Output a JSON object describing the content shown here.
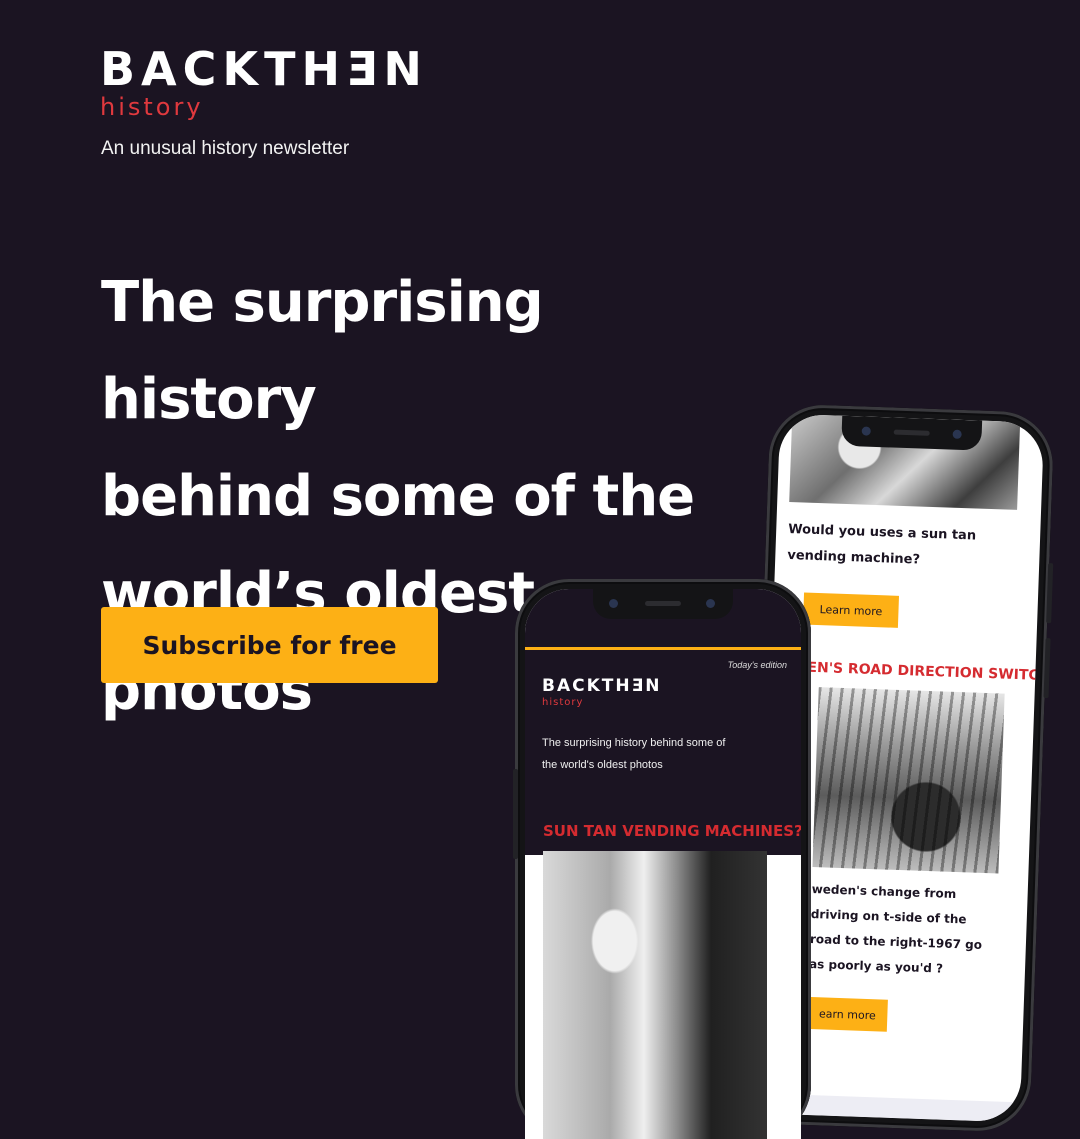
{
  "brand": {
    "wordmark": "BACKTHƎN",
    "sub": "history",
    "tagline": "An unusual history newsletter"
  },
  "headline": {
    "line1": "The surprising history",
    "line2": "behind some of the",
    "line3": "world’s oldest photos"
  },
  "cta": {
    "label": "Subscribe for free"
  },
  "back_phone": {
    "question": "Would you uses a sun tan vending machine?",
    "learn_more": "Learn more",
    "section_heading": "EN'S ROAD DIRECTION SWITCH",
    "body": "weden's change from driving on t-side of the road to the right-1967 go as poorly as you'd ?",
    "learn_more_2": "earn more"
  },
  "front_phone": {
    "edition": "Today's edition",
    "logo": "BACKTHƎN",
    "logo_sub": "history",
    "desc": "The surprising history behind some of the world's oldest photos",
    "section_heading": "SUN TAN VENDING MACHINES?"
  },
  "colors": {
    "background": "#1b1422",
    "accent": "#fdb015",
    "brand_red": "#e0393e",
    "headline_red": "#d52b30"
  }
}
